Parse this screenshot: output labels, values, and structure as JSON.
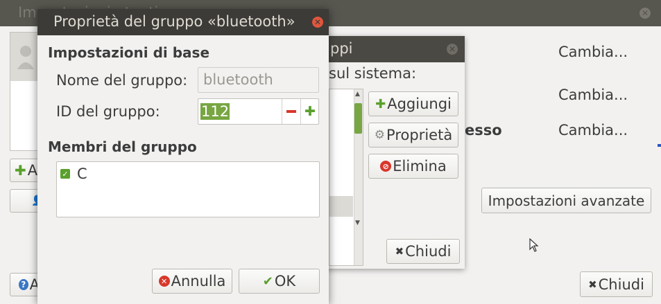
{
  "main_window": {
    "title": "Impostazioni utenti",
    "change_labels": [
      "Cambia...",
      "Cambia...",
      "Cambia..."
    ],
    "access_label_fragment": "esso",
    "advanced_button": "Impostazioni avanzate",
    "close_button": "Chiudi",
    "add_fragment": "A",
    "help_fragment": "A"
  },
  "groups_window": {
    "title_fragment": "ppi",
    "system_label_fragment": "sul sistema:",
    "add_button": "Aggiungi",
    "properties_button": "Proprietà",
    "delete_button": "Elimina",
    "close_button": "Chiudi"
  },
  "properties_dialog": {
    "title": "Proprietà del gruppo «bluetooth»",
    "basic_section": "Impostazioni di base",
    "name_label": "Nome del gruppo:",
    "name_value": "bluetooth",
    "id_label": "ID del gruppo:",
    "id_value": "112",
    "members_section": "Membri del gruppo",
    "members": [
      {
        "name": "C",
        "checked": true
      }
    ],
    "cancel_button": "Annulla",
    "ok_button": "OK"
  },
  "colors": {
    "accent_green": "#5aa02c",
    "delete_red": "#d8372b",
    "selection": "#77a642",
    "titlebar": "#3c3b37"
  }
}
